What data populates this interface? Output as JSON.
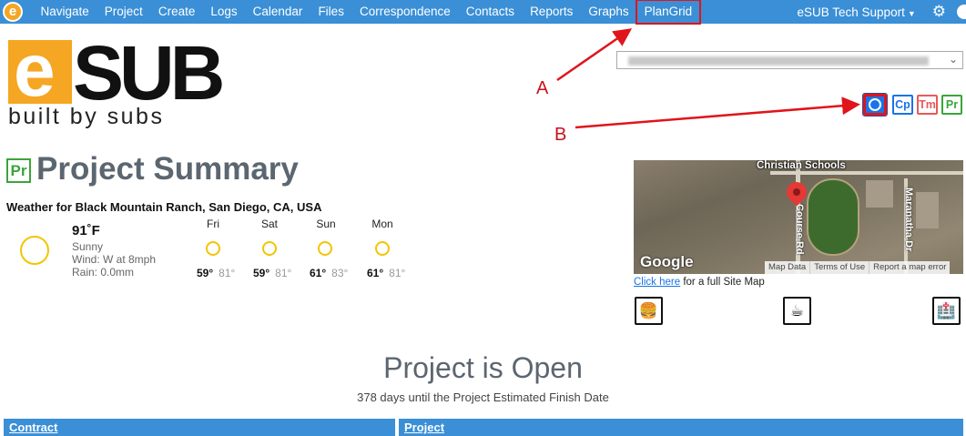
{
  "nav": {
    "logo_letter": "e",
    "items": [
      {
        "label": "Navigate"
      },
      {
        "label": "Project"
      },
      {
        "label": "Create"
      },
      {
        "label": "Logs"
      },
      {
        "label": "Calendar"
      },
      {
        "label": "Files"
      },
      {
        "label": "Correspondence"
      },
      {
        "label": "Contacts"
      },
      {
        "label": "Reports"
      },
      {
        "label": "Graphs"
      },
      {
        "label": "PlanGrid"
      }
    ],
    "user": "eSUB Tech Support",
    "highlighted_item": "PlanGrid"
  },
  "brand": {
    "logo_e": "e",
    "logo_sub": "SUB",
    "tagline": "built by subs",
    "accent": "#f5a623"
  },
  "annotations": {
    "a": "A",
    "b": "B",
    "color": "#e0151b"
  },
  "toolbar": {
    "cp": "Cp",
    "tm": "Tm",
    "pr": "Pr"
  },
  "page": {
    "badge": "Pr",
    "title": "Project Summary"
  },
  "weather": {
    "title": "Weather for Black Mountain Ranch, San Diego, CA, USA",
    "today": {
      "temp": "91˚F",
      "condition": "Sunny",
      "wind": "Wind: W at 8mph",
      "rain": "Rain: 0.0mm"
    },
    "forecast": [
      {
        "day": "Fri",
        "low": "59°",
        "high": "81°"
      },
      {
        "day": "Sat",
        "low": "59°",
        "high": "81°"
      },
      {
        "day": "Sun",
        "low": "61°",
        "high": "83°"
      },
      {
        "day": "Mon",
        "low": "61°",
        "high": "81°"
      }
    ]
  },
  "map": {
    "label_school": "Christian Schools",
    "street_1": "Course Rd",
    "street_2": "Maranatha Dr",
    "google": "Google",
    "footer": [
      "Map Data",
      "Terms of Use",
      "Report a map error"
    ],
    "link_text": "Click here",
    "link_suffix": " for a full Site Map"
  },
  "status": {
    "title": "Project is Open",
    "subtitle": "378 days until the Project Estimated Finish Date"
  },
  "sections": {
    "contract": "Contract",
    "project": "Project"
  },
  "colors": {
    "nav_blue": "#3a8fd6",
    "title_gray": "#5c6670"
  }
}
